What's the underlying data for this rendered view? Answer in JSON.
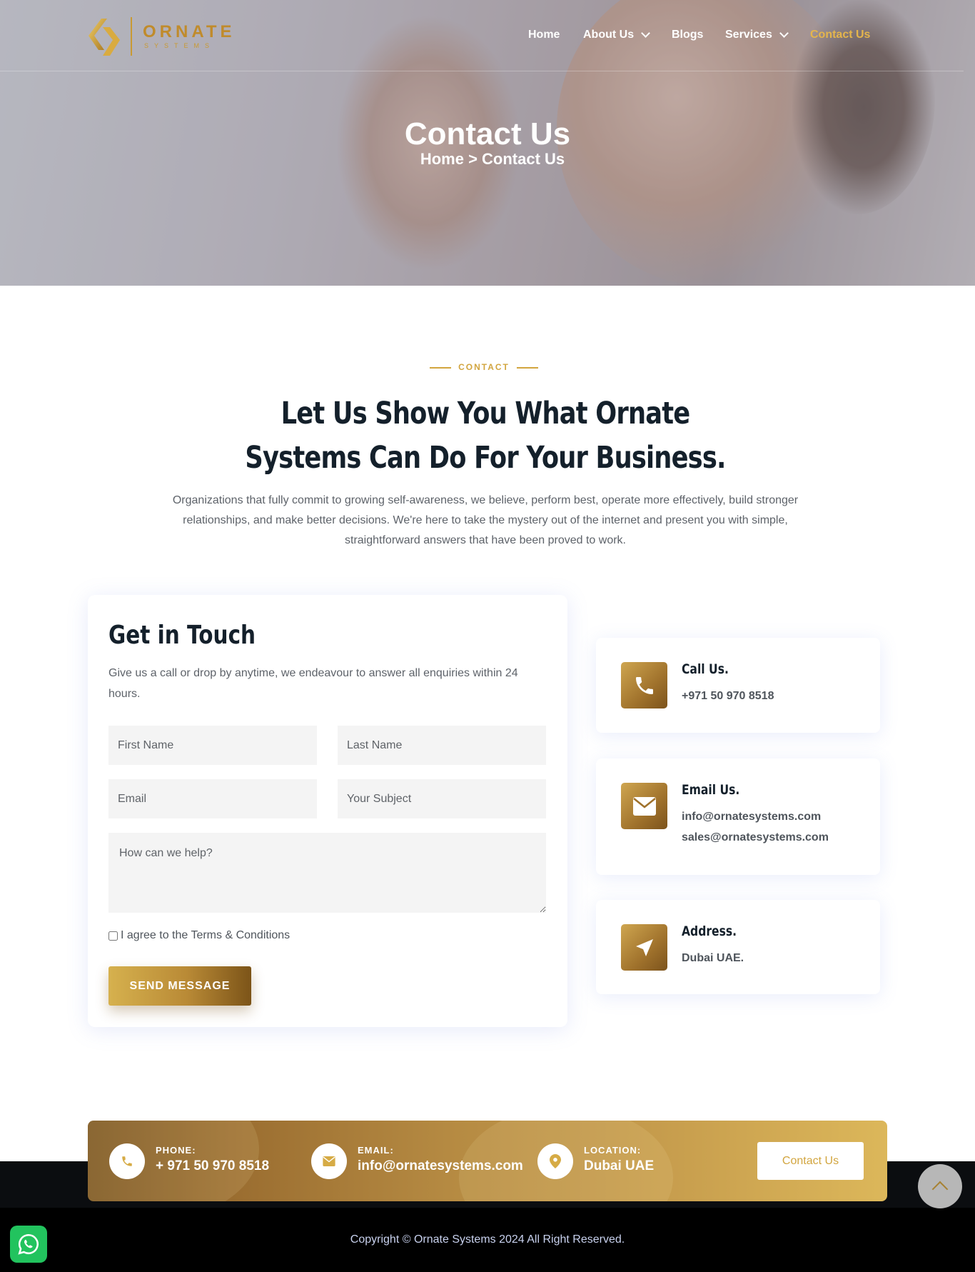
{
  "brand": {
    "name": "ORNATE",
    "tagline": "SYSTEMS",
    "gold_light": "#e4b54c",
    "gold_dark": "#7c5418"
  },
  "nav": {
    "items": [
      {
        "label": "Home",
        "has_dropdown": false,
        "active": false
      },
      {
        "label": "About Us",
        "has_dropdown": true,
        "active": false
      },
      {
        "label": "Blogs",
        "has_dropdown": false,
        "active": false
      },
      {
        "label": "Services",
        "has_dropdown": true,
        "active": false
      },
      {
        "label": "Contact Us",
        "has_dropdown": false,
        "active": true
      }
    ]
  },
  "hero": {
    "title": "Contact Us",
    "breadcrumb": "Home > Contact Us"
  },
  "intro": {
    "eyebrow": "CONTACT",
    "heading": "Let Us Show You What Ornate Systems Can Do For Your Business.",
    "paragraph": "Organizations that fully commit to growing self-awareness, we believe, perform best, operate more effectively, build stronger relationships, and make better decisions. We're here to take the mystery out of the internet and present you with simple, straightforward answers that have been proved to work."
  },
  "form": {
    "title": "Get in Touch",
    "description": "Give us a call or drop by anytime, we endeavour to answer all enquiries within 24 hours.",
    "first_name_placeholder": "First Name",
    "last_name_placeholder": "Last Name",
    "email_placeholder": "Email",
    "subject_placeholder": "Your Subject",
    "message_placeholder": "How can we help?",
    "agree_label": "I agree to the Terms & Conditions",
    "agree_checked": false,
    "submit_label": "SEND MESSAGE"
  },
  "info_cards": {
    "call": {
      "title": "Call Us.",
      "lines": [
        "+971 50 970 8518"
      ],
      "icon": "phone-icon"
    },
    "email": {
      "title": "Email Us.",
      "lines": [
        "info@ornatesystems.com",
        "sales@ornatesystems.com"
      ],
      "icon": "envelope-icon"
    },
    "address": {
      "title": "Address.",
      "lines": [
        "Dubai UAE."
      ],
      "icon": "location-arrow-icon"
    }
  },
  "cta_bar": {
    "phone": {
      "label": "PHONE:",
      "value": "+ 971 50 970 8518",
      "icon": "phone-icon"
    },
    "email": {
      "label": "EMAIL:",
      "value": "info@ornatesystems.com",
      "icon": "envelope-icon"
    },
    "location": {
      "label": "LOCATION:",
      "value": "Dubai UAE",
      "icon": "map-pin-icon"
    },
    "button_label": "Contact Us"
  },
  "footer": {
    "copyright": "Copyright © Ornate Systems 2024 All Right Reserved."
  },
  "floating": {
    "whatsapp_icon": "whatsapp-icon",
    "scroll_top_icon": "chevron-up-icon"
  }
}
